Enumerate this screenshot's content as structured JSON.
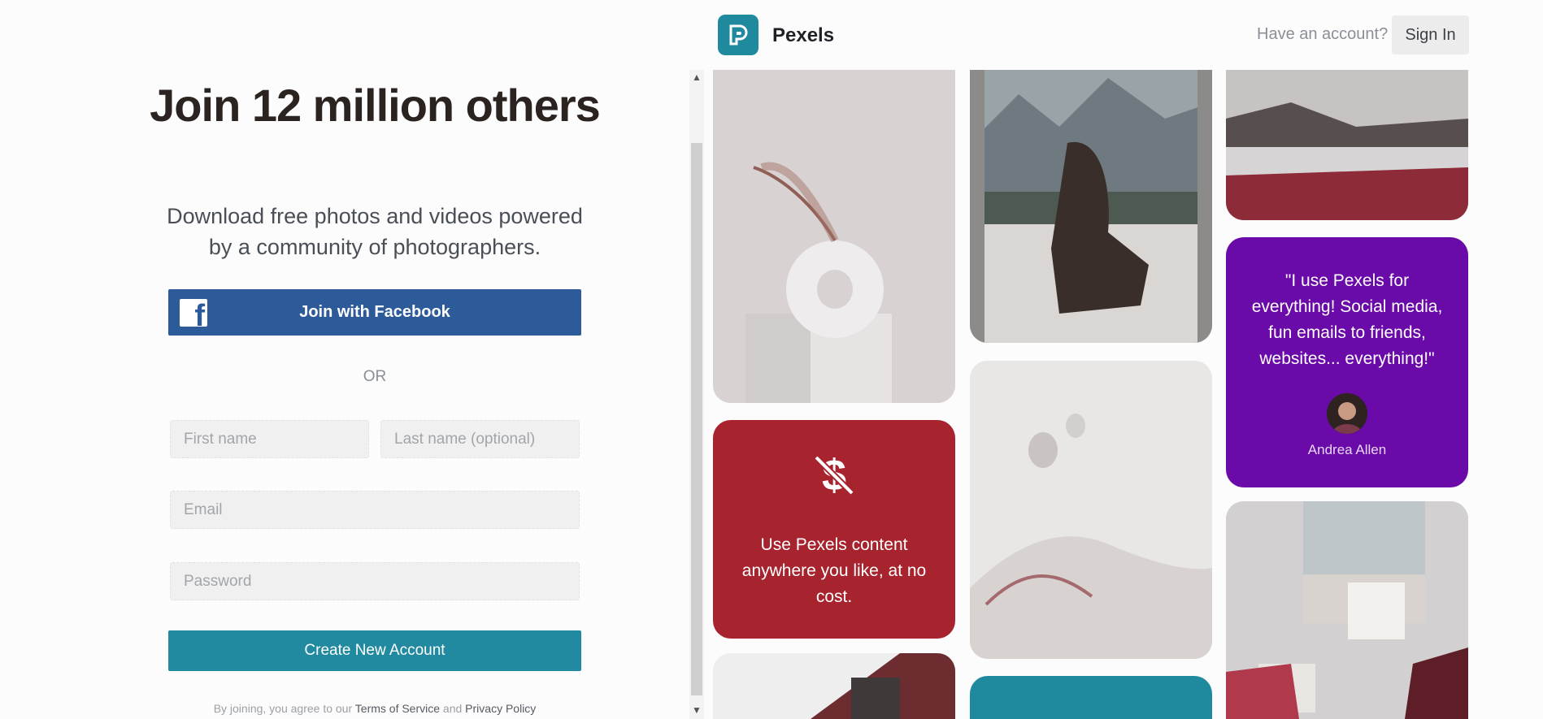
{
  "signup": {
    "title": "Join 12 million others",
    "subtitle": "Download free photos and videos powered by a community of photographers.",
    "facebook_button": "Join with Facebook",
    "or_label": "OR",
    "first_name_placeholder": "First name",
    "last_name_placeholder": "Last name (optional)",
    "email_placeholder": "Email",
    "password_placeholder": "Password",
    "create_button": "Create New Account",
    "terms_prefix": "By joining, you agree to our",
    "terms_link": "Terms of Service",
    "terms_and": "and",
    "privacy_link": "Privacy Policy"
  },
  "header": {
    "brand": "Pexels",
    "have_account": "Have an account?",
    "sign_in": "Sign In"
  },
  "promo": {
    "text": "Use Pexels content anywhere you like, at no cost.",
    "icon": "no-dollar-icon"
  },
  "testimonial": {
    "quote": "\"I use Pexels for everything! Social media, fun emails to friends, websites... everything!\"",
    "author": "Andrea Allen"
  },
  "colors": {
    "facebook": "#2d5b9a",
    "teal": "#218aa0",
    "promo_red": "#a7232d",
    "testimonial_purple": "#6a0aa8"
  }
}
